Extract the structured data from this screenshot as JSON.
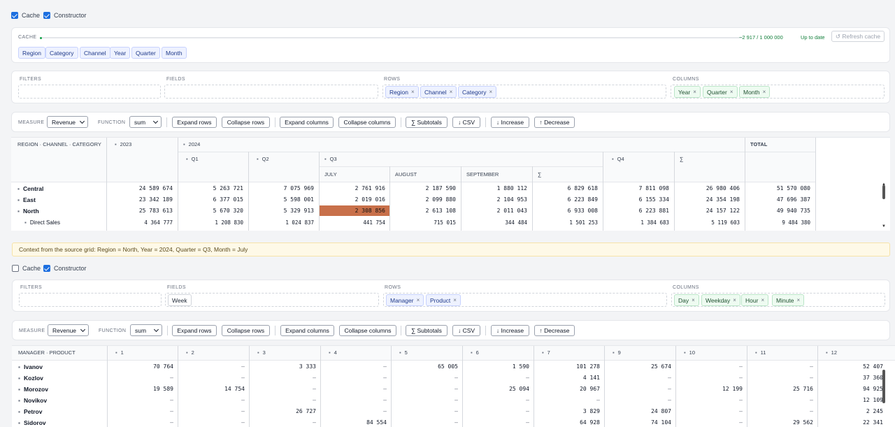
{
  "top": {
    "cache_checkbox": {
      "label": "Cache",
      "checked": true
    },
    "constructor_checkbox": {
      "label": "Constructor",
      "checked": true
    }
  },
  "cache_card": {
    "label": "CACHE",
    "count": "~2 917 / 1 000 000",
    "status": "Up to date",
    "refresh_label": "↺ Refresh cache",
    "progress": 0.003,
    "chips": [
      "Region",
      "Category",
      "Channel",
      "Year",
      "Quarter",
      "Month"
    ]
  },
  "zones1": {
    "filters_label": "FILTERS",
    "fields_label": "FIELDS",
    "rows_label": "ROWS",
    "columns_label": "COLUMNS",
    "rows": [
      "Region",
      "Channel",
      "Category"
    ],
    "columns": [
      "Year",
      "Quarter",
      "Month"
    ]
  },
  "toolbar1": {
    "measure_label": "MEASURE",
    "measure_value": "Revenue",
    "function_label": "FUNCTION",
    "function_value": "sum",
    "expand_rows": "Expand rows",
    "collapse_rows": "Collapse rows",
    "expand_columns": "Expand columns",
    "collapse_columns": "Collapse columns",
    "subtotals": "∑ Subtotals",
    "csv": "↓ CSV",
    "increase": "↓ Increase",
    "decrease": "↑ Decrease"
  },
  "grid1": {
    "corner": "REGION · CHANNEL · CATEGORY",
    "y2023": "2023",
    "y2024": "2024",
    "q1": "Q1",
    "q2": "Q2",
    "q3": "Q3",
    "q4": "Q4",
    "july": "JULY",
    "august": "AUGUST",
    "september": "SEPTEMBER",
    "sigma_q": "∑",
    "sigma_y": "∑",
    "total": "TOTAL",
    "rows": [
      {
        "label": "Central",
        "values": [
          "24 589 674",
          "5 263 721",
          "7 075 969",
          "2 761 916",
          "2 187 590",
          "1 880 112",
          "6 829 618",
          "7 811 098",
          "26 980 406",
          "51 570 080"
        ]
      },
      {
        "label": "East",
        "values": [
          "23 342 189",
          "6 377 015",
          "5 598 001",
          "2 019 016",
          "2 099 880",
          "2 104 953",
          "6 223 849",
          "6 155 334",
          "24 354 198",
          "47 696 387"
        ]
      },
      {
        "label": "North",
        "values": [
          "25 783 613",
          "5 670 320",
          "5 329 913",
          "2 308 856",
          "2 613 108",
          "2 011 043",
          "6 933 008",
          "6 223 881",
          "24 157 122",
          "49 940 735"
        ]
      },
      {
        "label": "Direct Sales",
        "values": [
          "4 364 777",
          "1 208 830",
          "1 024 837",
          "441 754",
          "715 015",
          "344 484",
          "1 501 253",
          "1 384 683",
          "5 119 603",
          "9 484 380"
        ]
      }
    ]
  },
  "context_bar": "Context from the source grid: Region = North, Year = 2024, Quarter = Q3, Month = July",
  "second": {
    "cache_checkbox": {
      "label": "Cache",
      "checked": false
    },
    "constructor_checkbox": {
      "label": "Constructor",
      "checked": true
    },
    "fields": [
      "Week"
    ],
    "rows": [
      "Manager",
      "Product"
    ],
    "columns": [
      "Day",
      "Weekday",
      "Hour",
      "Minute"
    ]
  },
  "grid2": {
    "corner": "MANAGER · PRODUCT",
    "cols": [
      "1",
      "2",
      "3",
      "4",
      "5",
      "6",
      "7",
      "9",
      "10",
      "11",
      "12"
    ],
    "rows": [
      {
        "label": "Ivanov",
        "values": [
          "70 764",
          "–",
          "3 333",
          "–",
          "65 005",
          "1 590",
          "101 278",
          "25 674",
          "–",
          "–",
          "52 407"
        ]
      },
      {
        "label": "Kozlov",
        "values": [
          "–",
          "–",
          "–",
          "–",
          "–",
          "–",
          "4 141",
          "–",
          "–",
          "–",
          "37 360"
        ]
      },
      {
        "label": "Morozov",
        "values": [
          "19 589",
          "14 754",
          "–",
          "–",
          "–",
          "25 094",
          "20 967",
          "–",
          "12 199",
          "25 716",
          "94 925"
        ]
      },
      {
        "label": "Novikov",
        "values": [
          "–",
          "–",
          "–",
          "–",
          "–",
          "–",
          "–",
          "–",
          "–",
          "–",
          "12 109"
        ]
      },
      {
        "label": "Petrov",
        "values": [
          "–",
          "–",
          "26 727",
          "–",
          "–",
          "–",
          "3 829",
          "24 807",
          "–",
          "–",
          "2 245"
        ]
      },
      {
        "label": "Sidorov",
        "values": [
          "–",
          "–",
          "–",
          "84 554",
          "–",
          "–",
          "64 928",
          "74 104",
          "–",
          "29 562",
          "22 341"
        ]
      }
    ]
  }
}
